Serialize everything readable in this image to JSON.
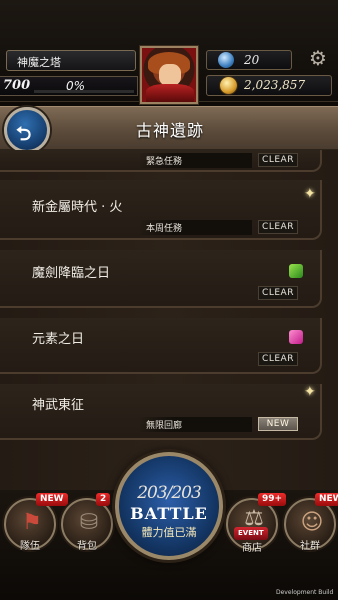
{
  "top": {
    "tower": "神魔之塔",
    "level": "700",
    "exp_percent": "0%",
    "gems": "20",
    "gold": "2,023,857"
  },
  "banner": {
    "title": "古神遺跡"
  },
  "list": {
    "items": [
      {
        "title": "",
        "subtitle": "緊急任務",
        "badge": "CLEAR"
      },
      {
        "title": "新金屬時代 · 火",
        "subtitle": "本周任務",
        "badge": "CLEAR"
      },
      {
        "title": "魔劍降臨之日",
        "subtitle": "",
        "badge": "CLEAR"
      },
      {
        "title": "元素之日",
        "subtitle": "",
        "badge": "CLEAR"
      },
      {
        "title": "神武東征",
        "subtitle": "無限回廊",
        "badge": "NEW"
      }
    ]
  },
  "nav": {
    "team": {
      "label": "隊伍",
      "notif": "NEW"
    },
    "bag": {
      "label": "背包",
      "notif": "2"
    },
    "battle": {
      "stamina": "203/203",
      "label": "BATTLE",
      "status": "體力值已滿"
    },
    "shop": {
      "label": "商店",
      "notif": "99+",
      "tag": "EVENT"
    },
    "social": {
      "label": "社群",
      "notif": "NEW"
    }
  },
  "footer": {
    "build": "Development Build"
  },
  "colors": {
    "accent": "#2c5ea8",
    "notification": "#e02525"
  }
}
